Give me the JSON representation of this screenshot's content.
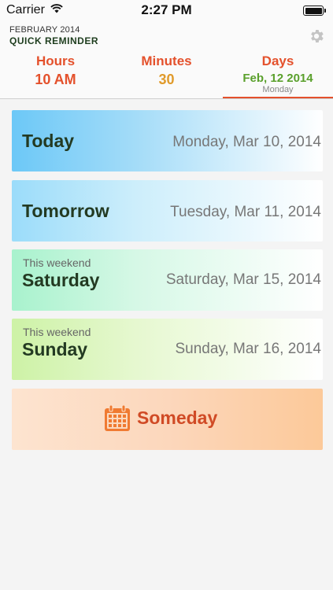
{
  "status_bar": {
    "carrier": "Carrier",
    "time": "2:27 PM",
    "wifi_icon": "wifi-icon",
    "battery_icon": "battery-icon"
  },
  "header": {
    "subtitle": "FEBRUARY 2014",
    "title": "QUICK REMINDER",
    "settings_icon": "gear-icon"
  },
  "tabs": {
    "hours": {
      "label": "Hours",
      "value": "10 AM"
    },
    "minutes": {
      "label": "Minutes",
      "value": "30"
    },
    "days": {
      "label": "Days",
      "value": "Feb, 12 2014",
      "sub": "Monday",
      "selected": true
    }
  },
  "options": [
    {
      "name": "Today",
      "pre": "",
      "date": "Monday, Mar 10, 2014"
    },
    {
      "name": "Tomorrow",
      "pre": "",
      "date": "Tuesday, Mar 11, 2014"
    },
    {
      "name": "Saturday",
      "pre": "This weekend",
      "date": "Saturday, Mar 15, 2014"
    },
    {
      "name": "Sunday",
      "pre": "This weekend",
      "date": "Sunday, Mar 16, 2014"
    }
  ],
  "someday": {
    "label": "Someday",
    "icon": "calendar-icon"
  },
  "colors": {
    "accent": "#e4512c",
    "minutes_value": "#e09a2a",
    "days_value": "#5aa02c",
    "title_green": "#1e3d1e"
  }
}
